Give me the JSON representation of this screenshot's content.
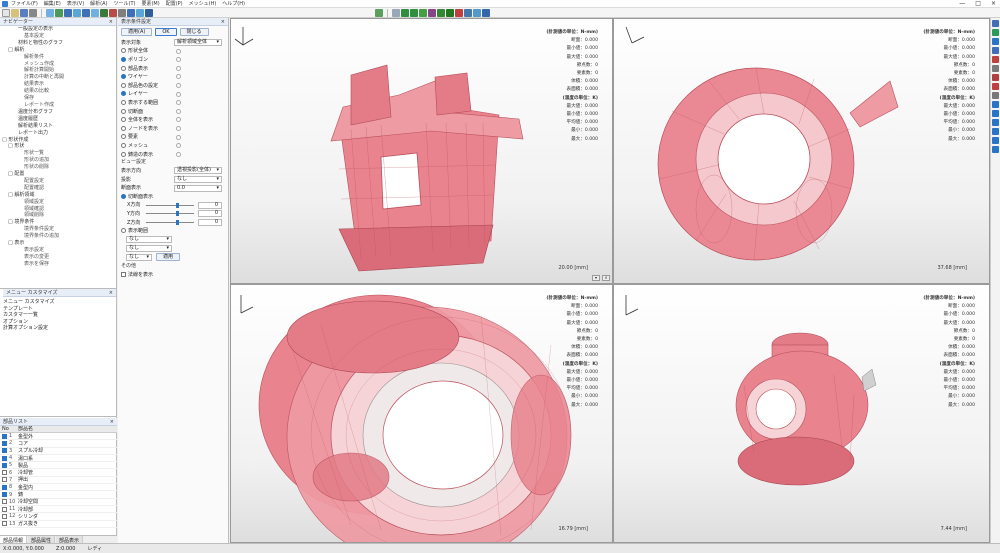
{
  "menubar": [
    "ファイル(F)",
    "編集(E)",
    "表示(V)",
    "解析(A)",
    "ツール(T)",
    "要素(M)",
    "配置(P)",
    "メッシュ(H)",
    "ヘルプ(H)"
  ],
  "window_controls": [
    "—",
    "□",
    "×"
  ],
  "tree_panel": {
    "title": "ナビゲーター",
    "items": [
      {
        "level": 2,
        "text": "一般設定の表示"
      },
      {
        "level": 3,
        "text": "基本設定"
      },
      {
        "level": 2,
        "text": "材料と物性のグラフ"
      },
      {
        "level": 1,
        "text": "□ 解析"
      },
      {
        "level": 3,
        "text": "解析条件"
      },
      {
        "level": 3,
        "text": "メッシュ作成"
      },
      {
        "level": 3,
        "text": "解析計算開始"
      },
      {
        "level": 3,
        "text": "計算の中断と再開"
      },
      {
        "level": 3,
        "text": "結果表示"
      },
      {
        "level": 3,
        "text": "結果の比較"
      },
      {
        "level": 3,
        "text": "保存"
      },
      {
        "level": 3,
        "text": "レポート作成"
      },
      {
        "level": 2,
        "text": "温度分布グラフ"
      },
      {
        "level": 2,
        "text": "温度履歴"
      },
      {
        "level": 2,
        "text": "解析結果リスト"
      },
      {
        "level": 2,
        "text": "レポート出力"
      },
      {
        "level": 0,
        "text": "□ 形状作成"
      },
      {
        "level": 1,
        "text": "□ 形状"
      },
      {
        "level": 3,
        "text": "形状一覧"
      },
      {
        "level": 3,
        "text": "形状の追加"
      },
      {
        "level": 3,
        "text": "形状の削除"
      },
      {
        "level": 1,
        "text": "□ 配置"
      },
      {
        "level": 3,
        "text": "配置設定"
      },
      {
        "level": 3,
        "text": "配置確認"
      },
      {
        "level": 1,
        "text": "□ 解析領域"
      },
      {
        "level": 3,
        "text": "領域設定"
      },
      {
        "level": 3,
        "text": "領域確認"
      },
      {
        "level": 3,
        "text": "領域削除"
      },
      {
        "level": 1,
        "text": "□ 境界条件"
      },
      {
        "level": 3,
        "text": "境界条件設定"
      },
      {
        "level": 3,
        "text": "境界条件の追加"
      },
      {
        "level": 1,
        "text": "□ 表示"
      },
      {
        "level": 3,
        "text": "表示設定"
      },
      {
        "level": 3,
        "text": "表示の変更"
      },
      {
        "level": 3,
        "text": "表示を保存"
      }
    ]
  },
  "custom_panel": {
    "title": "メニュー カスタマイズ",
    "items": [
      "メニュー カスタマイズ",
      "テンプレート",
      "カスタマー一覧",
      "オプション",
      "計算オプション設定"
    ]
  },
  "parts_panel": {
    "title": "部品リスト",
    "col_no": "No",
    "col_name": "部品名",
    "rows": [
      {
        "no": "1",
        "name": "金型外",
        "on": true
      },
      {
        "no": "2",
        "name": "コア",
        "on": true
      },
      {
        "no": "3",
        "name": "スプル冷却",
        "on": true
      },
      {
        "no": "4",
        "name": "湯口系",
        "on": true
      },
      {
        "no": "5",
        "name": "製品",
        "on": true
      },
      {
        "no": "6",
        "name": "冷却管",
        "on": false
      },
      {
        "no": "7",
        "name": "押出",
        "on": false
      },
      {
        "no": "8",
        "name": "金型内",
        "on": true
      },
      {
        "no": "9",
        "name": "鋳",
        "on": true
      },
      {
        "no": "10",
        "name": "冷却空間",
        "on": false
      },
      {
        "no": "11",
        "name": "冷却部",
        "on": false
      },
      {
        "no": "12",
        "name": "シリンダ",
        "on": false
      },
      {
        "no": "13",
        "name": "ガス抜き",
        "on": false
      }
    ],
    "tabs": [
      "部品情報",
      "部品属性",
      "部品表示"
    ]
  },
  "settings_panel": {
    "title": "表示条件設定",
    "btn_apply": "適用(A)",
    "btn_ok": "OK",
    "btn_cancel": "閉じる",
    "target_label": "表示対象",
    "target_value": "解析領域全体",
    "options": [
      {
        "label": "形状全体",
        "on": false
      },
      {
        "label": "ポリゴン",
        "on": true
      },
      {
        "label": "部品表示",
        "on": false
      },
      {
        "label": "ワイヤー",
        "on": true
      },
      {
        "label": "部品色の設定",
        "on": false
      },
      {
        "label": "レイヤー",
        "on": true
      },
      {
        "label": "表示する範囲",
        "on": false
      },
      {
        "label": "切断面",
        "on": false
      },
      {
        "label": "全体を表示",
        "on": false
      },
      {
        "label": "ノードを表示",
        "on": false
      },
      {
        "label": "要素",
        "on": false
      },
      {
        "label": "メッシュ",
        "on": false
      },
      {
        "label": "鋳造の表示",
        "on": false
      }
    ],
    "section_view": "ビュー設定",
    "view_label": "表示方向",
    "view_value": "透視投影(全体)",
    "projection_label": "投影",
    "projection_value": "なし",
    "section_label": "断面表示",
    "section_value": "0.0",
    "radio_cut": "切断面表示",
    "axes": [
      {
        "axis": "X方向",
        "value": "0"
      },
      {
        "axis": "Y方向",
        "value": "0"
      },
      {
        "axis": "Z方向",
        "value": "0"
      }
    ],
    "radio_range": "表示範囲",
    "range_dd1": "なし",
    "range_dd2": "なし",
    "range_dd3": "なし",
    "apply_small": "適用",
    "extra_label": "その他",
    "extra_check": "法線を表示"
  },
  "viewports": [
    {
      "info": [
        "(計測値の単位：N-mm)",
        "断面：0.000",
        "最小値：0.000",
        "最大値：0.000",
        "節点数：0",
        "要素数：0",
        "体積：0.000",
        "表面積：0.000",
        "(温度の単位：K)",
        "最大値：0.000",
        "最小値：0.000",
        "平均値：0.000",
        "最小：0.000",
        "最大：0.000"
      ],
      "scale": "20.00 [mm]"
    },
    {
      "info": [
        "(計測値の単位：N-mm)",
        "断面：0.000",
        "最小値：0.000",
        "最大値：0.000",
        "節点数：0",
        "要素数：0",
        "体積：0.000",
        "表面積：0.000",
        "(温度の単位：K)",
        "最大値：0.000",
        "最小値：0.000",
        "平均値：0.000",
        "最小：0.000",
        "最大：0.000"
      ],
      "scale": "37.68 [mm]"
    },
    {
      "info": [
        "(計測値の単位：N-mm)",
        "断面：0.000",
        "最小値：0.000",
        "最大値：0.000",
        "節点数：0",
        "要素数：0",
        "体積：0.000",
        "表面積：0.000",
        "(温度の単位：K)",
        "最大値：0.000",
        "最小値：0.000",
        "平均値：0.000",
        "最小：0.000",
        "最大：0.000"
      ],
      "scale": "16.79 [mm]"
    },
    {
      "info": [
        "(計測値の単位：N-mm)",
        "断面：0.000",
        "最小値：0.000",
        "最大値：0.000",
        "節点数：0",
        "要素数：0",
        "体積：0.000",
        "表面積：0.000",
        "(温度の単位：K)",
        "最大値：0.000",
        "最小値：0.000",
        "平均値：0.000",
        "最小：0.000",
        "最大：0.000"
      ],
      "scale": "7.44 [mm]"
    }
  ],
  "status": [
    "X:0.000, Y:0.000",
    "Z:0.000",
    "レディ"
  ],
  "colors": {
    "model_fill": "#e8818c",
    "model_dark": "#b9505c",
    "model_light": "#f3c3c8",
    "accent": "#2a74c8"
  }
}
